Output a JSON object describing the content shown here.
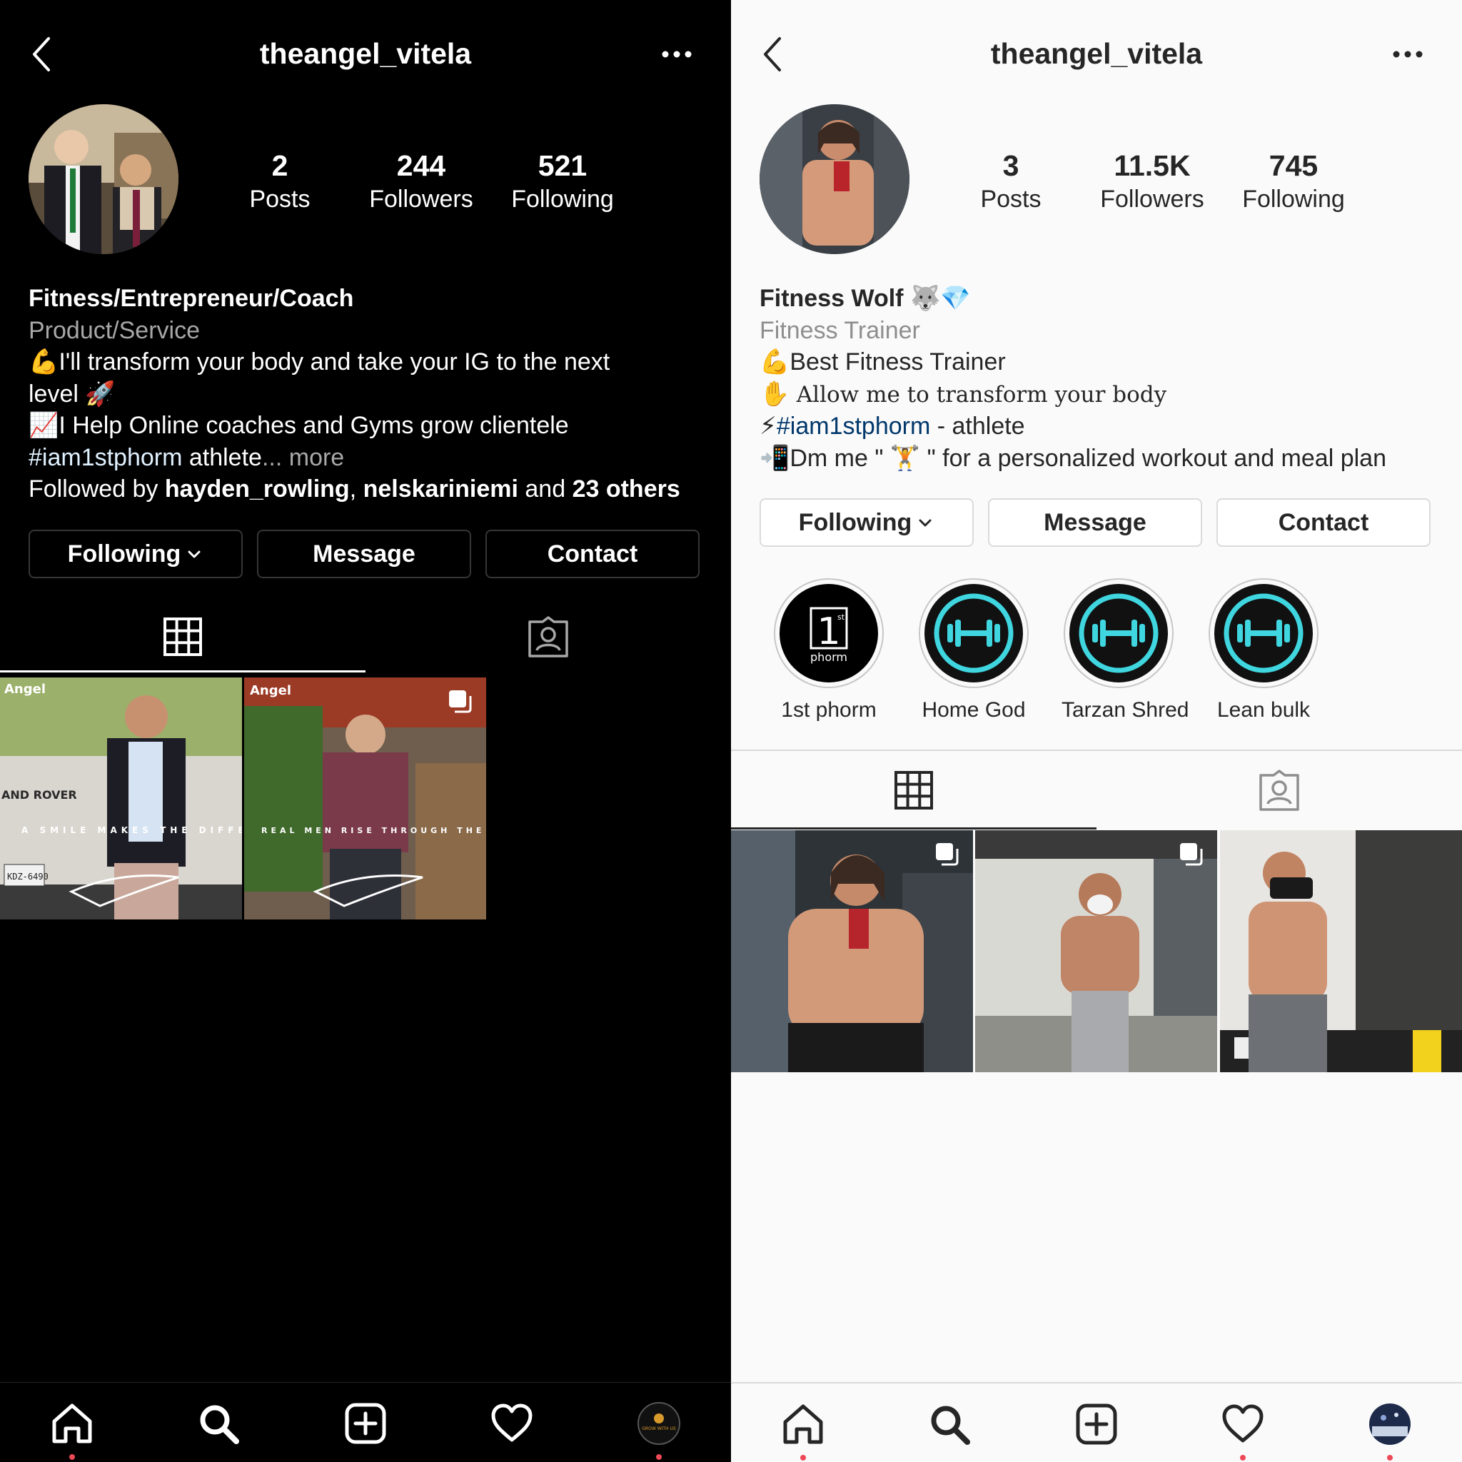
{
  "left_profile": {
    "username": "theangel_vitela",
    "stats": [
      {
        "value": "2",
        "label": "Posts"
      },
      {
        "value": "244",
        "label": "Followers"
      },
      {
        "value": "521",
        "label": "Following"
      }
    ],
    "bio": {
      "name": "Fitness/Entrepreneur/Coach",
      "category": "Product/Service",
      "line1_emoji": "💪",
      "line1": "I'll transform your body and take your IG to the next",
      "line2": "level",
      "line2_emoji": "🚀",
      "line3_emoji": "📈",
      "line3": "I Help Online coaches and Gyms grow clientele",
      "hashtag": "#iam1stphorm",
      "line4_rest": " athlete",
      "ellipsis": "...",
      "more": " more",
      "followed_prefix": "Followed by ",
      "followed_user1": "hayden_rowling",
      "followed_sep": ", ",
      "followed_user2": "nelskariniemi",
      "followed_and": " and ",
      "followed_others": "23 others"
    },
    "buttons": {
      "following": "Following",
      "message": "Message",
      "contact": "Contact"
    },
    "posts": [
      {
        "brand": "Angel",
        "caption": "A SMILE MAKES THE DIFFERENCE",
        "car_text": "AND ROVER",
        "plate": "KDZ-6490"
      },
      {
        "brand": "Angel",
        "caption": "REAL MEN RISE THROUGH THE TOUGHEST TIMES"
      }
    ],
    "bottom_nav": [
      "home-icon",
      "search-icon",
      "new-post-icon",
      "activity-heart-icon",
      "profile-avatar"
    ],
    "bottom_nav_avatar_text": "GROW WITH US"
  },
  "right_profile": {
    "username": "theangel_vitela",
    "stats": [
      {
        "value": "3",
        "label": "Posts"
      },
      {
        "value": "11.5K",
        "label": "Followers"
      },
      {
        "value": "745",
        "label": "Following"
      }
    ],
    "bio": {
      "name": "Fitness Wolf",
      "name_emojis": "🐺💎",
      "category": "Fitness Trainer",
      "line1_emoji": "💪",
      "line1": "Best Fitness Trainer",
      "line2_emoji": "✋",
      "line2": "Allow me to transform your body",
      "line3_emoji": "⚡",
      "hashtag": "#iam1stphorm",
      "line3_rest": " - athlete",
      "line4_emoji": "📲",
      "line4_a": "Dm me \" ",
      "line4_emoji2": "🏋",
      "line4_b": " \" for a personalized workout and meal plan"
    },
    "buttons": {
      "following": "Following",
      "message": "Message",
      "contact": "Contact"
    },
    "highlights": [
      {
        "label": "1st phorm",
        "logo_num": "1",
        "logo_sup": "st",
        "logo_text": "phorm"
      },
      {
        "label": "Home God"
      },
      {
        "label": "Tarzan Shred"
      },
      {
        "label": "Lean bulk"
      }
    ],
    "accent_color": "#3fd6e0",
    "bottom_nav": [
      "home-icon",
      "search-icon",
      "new-post-icon",
      "activity-heart-icon",
      "profile-avatar"
    ]
  }
}
